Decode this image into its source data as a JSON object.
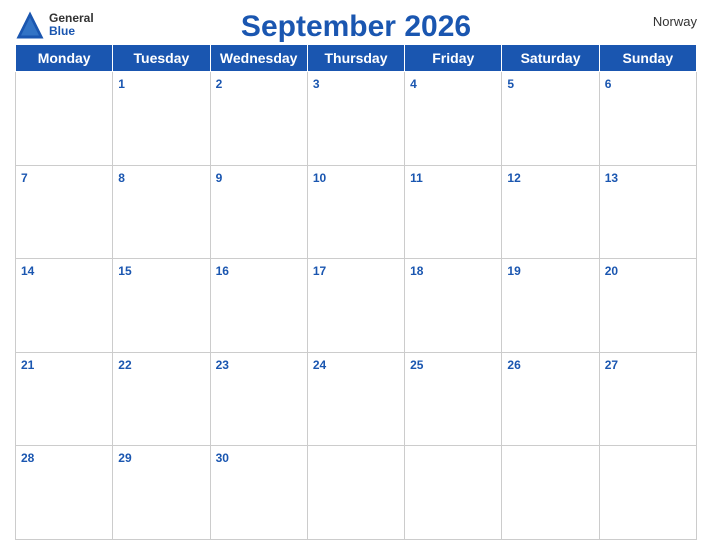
{
  "header": {
    "title": "September 2026",
    "country": "Norway",
    "logo": {
      "general": "General",
      "blue": "Blue"
    }
  },
  "days": [
    "Monday",
    "Tuesday",
    "Wednesday",
    "Thursday",
    "Friday",
    "Saturday",
    "Sunday"
  ],
  "weeks": [
    [
      "",
      "1",
      "2",
      "3",
      "4",
      "5",
      "6"
    ],
    [
      "7",
      "8",
      "9",
      "10",
      "11",
      "12",
      "13"
    ],
    [
      "14",
      "15",
      "16",
      "17",
      "18",
      "19",
      "20"
    ],
    [
      "21",
      "22",
      "23",
      "24",
      "25",
      "26",
      "27"
    ],
    [
      "28",
      "29",
      "30",
      "",
      "",
      "",
      ""
    ]
  ]
}
